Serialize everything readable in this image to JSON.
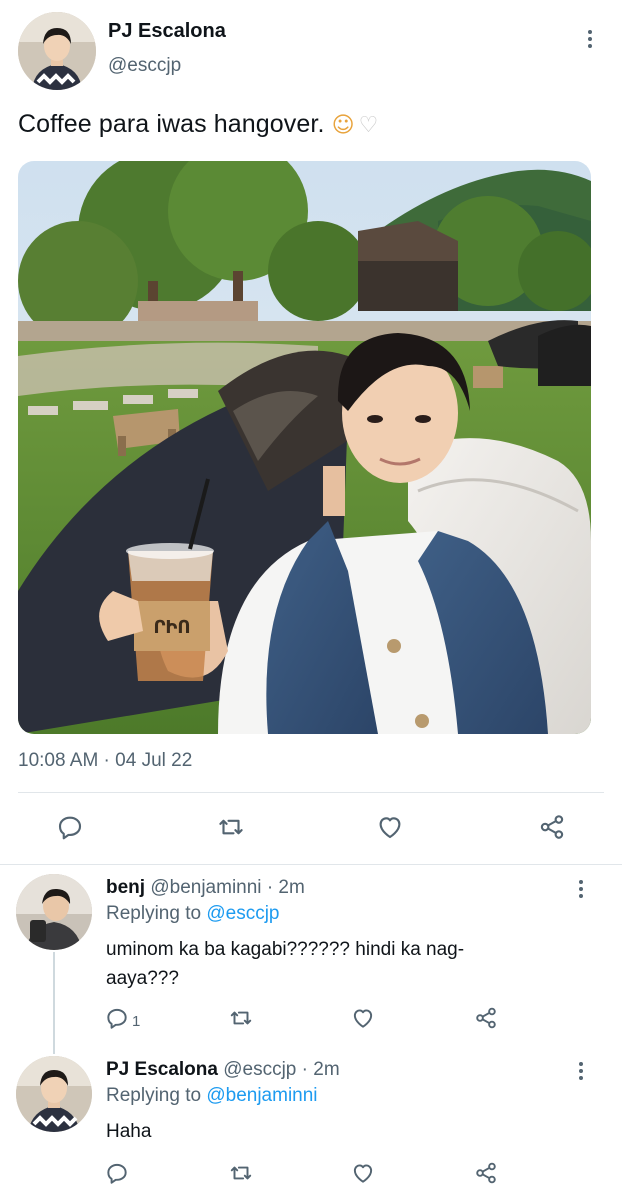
{
  "main_tweet": {
    "author_name": "PJ Escalona",
    "author_handle": "@esccjp",
    "text": "Coffee para iwas hangover. ",
    "emojis": [
      "☺",
      "♡"
    ],
    "timestamp": "10:08 AM · 04 Jul 22",
    "media_icon": "photo-man-with-iced-coffee"
  },
  "replies": [
    {
      "author_name": "benj",
      "author_handle": "@benjaminni",
      "separator": "·",
      "time": "2m",
      "replying_prefix": "Replying to ",
      "replying_to": "@esccjp",
      "text_line1": "uminom ka ba kagabi?????? hindi ka nag-",
      "text_line2": "aaya???",
      "reply_count": "1"
    },
    {
      "author_name": "PJ Escalona",
      "author_handle": "@esccjp",
      "separator": "·",
      "time": "2m",
      "replying_prefix": "Replying to ",
      "replying_to": "@benjaminni",
      "text_line1": "Haha"
    }
  ],
  "icons": [
    "reply-icon",
    "retweet-icon",
    "like-icon",
    "share-icon",
    "more-icon"
  ],
  "colors": {
    "link": "#1d9bf0",
    "secondary": "#536471",
    "text": "#0f1419"
  }
}
